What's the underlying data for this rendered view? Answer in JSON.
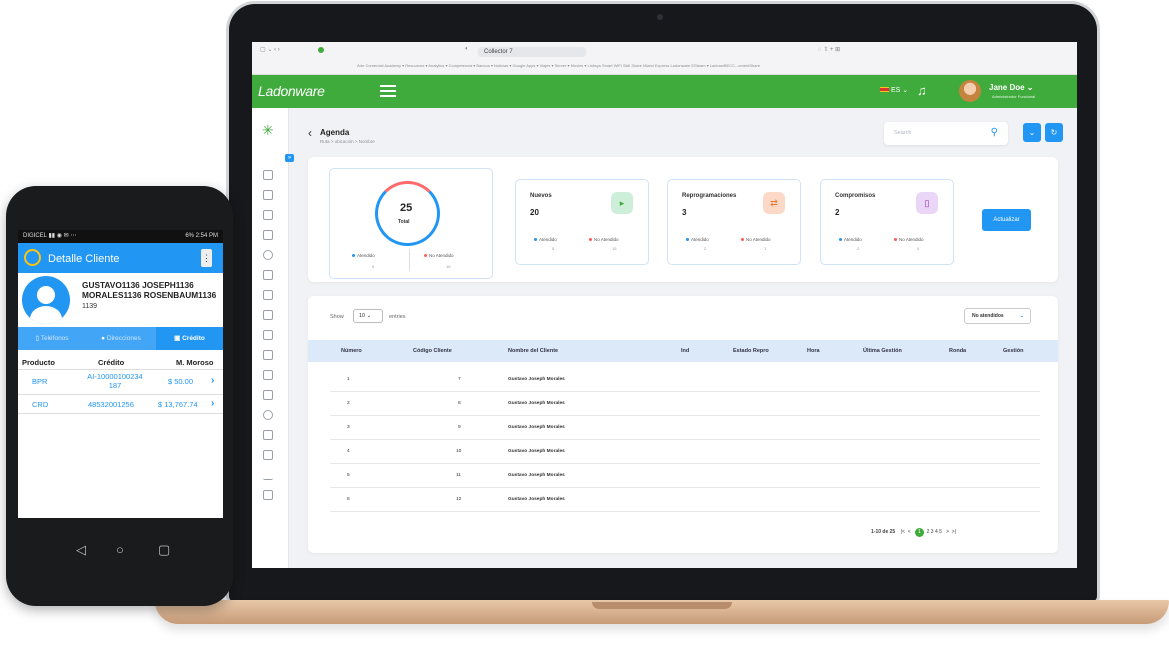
{
  "laptop": {
    "browser": {
      "url": "Collector 7",
      "bookmarks": "Arte Comercial   Academy ▾   Resources ▾   Analytics ▾   Competencia ▾   Bancos ▾   Noticias ▾   Google Apps ▾   Viajes ▾   Server ▾   Movies ▾   Linksys Smart WiFi   Skill Share   Miami Express   Ladonware   ESteam ▾   LadonwBECC...omentShare"
    },
    "header": {
      "logo": "Ladonware",
      "lang": "ES",
      "user_name": "Jane Doe",
      "user_role": "Administrador Funcional"
    },
    "page": {
      "title": "Agenda",
      "breadcrumb": "Ruta  >  ubicación  >  Nombre",
      "search_placeholder": "Search"
    },
    "stats": {
      "total": {
        "value": "25",
        "label": "Total",
        "attended_label": "Atendido",
        "attended": "9",
        "not_attended_label": "No Atendido",
        "not_attended": "16"
      },
      "cards": [
        {
          "title": "Nuevos",
          "value": "20",
          "attended": "5",
          "not_attended": "15",
          "icon": "calendar-play-icon"
        },
        {
          "title": "Reprogramaciones",
          "value": "3",
          "attended": "2",
          "not_attended": "1",
          "icon": "repeat-icon"
        },
        {
          "title": "Compromisos",
          "value": "2",
          "attended": "2",
          "not_attended": "0",
          "icon": "bookmark-icon"
        }
      ],
      "attended_label": "Atendido",
      "not_attended_label": "No Atendido",
      "update_button": "Actualizar"
    },
    "table": {
      "show_label": "Show",
      "entries_value": "10",
      "entries_label": "entries",
      "filter_value": "No atendidos",
      "columns": [
        "Número",
        "Código Cliente",
        "Nombre del Cliente",
        "Ind",
        "Estado Repro",
        "Hora",
        "Última Gestión",
        "Ronda",
        "Gestión"
      ],
      "rows": [
        {
          "num": "1",
          "code": "7",
          "name": "Gustavo Joseph Morales"
        },
        {
          "num": "2",
          "code": "8",
          "name": "Gustavo Joseph Morales"
        },
        {
          "num": "3",
          "code": "9",
          "name": "Gustavo Joseph Morales"
        },
        {
          "num": "4",
          "code": "10",
          "name": "Gustavo Joseph Morales"
        },
        {
          "num": "5",
          "code": "11",
          "name": "Gustavo Joseph Morales"
        },
        {
          "num": "6",
          "code": "12",
          "name": "Gustavo Joseph Morales"
        }
      ],
      "pagination": {
        "range": "1-10 de 25",
        "active": "1",
        "pages": "2   3   4   5"
      }
    }
  },
  "phone": {
    "status_left": "DIGICEL",
    "status_right": "6%  2:54 PM",
    "title": "Detalle Cliente",
    "client_name": "GUSTAVO1136 JOSEPH1136 MORALES1136 ROSENBAUM1136",
    "client_id": "1139",
    "tabs": [
      "Teléfonos",
      "Direcciones",
      "Crédito"
    ],
    "columns": [
      "Producto",
      "Crédito",
      "M. Moroso"
    ],
    "rows": [
      {
        "product": "BPR",
        "credit": "AI-10000100234 187",
        "amount": "$ 50.00"
      },
      {
        "product": "CRD",
        "credit": "48532001256",
        "amount": "$ 13,767.74"
      }
    ]
  }
}
